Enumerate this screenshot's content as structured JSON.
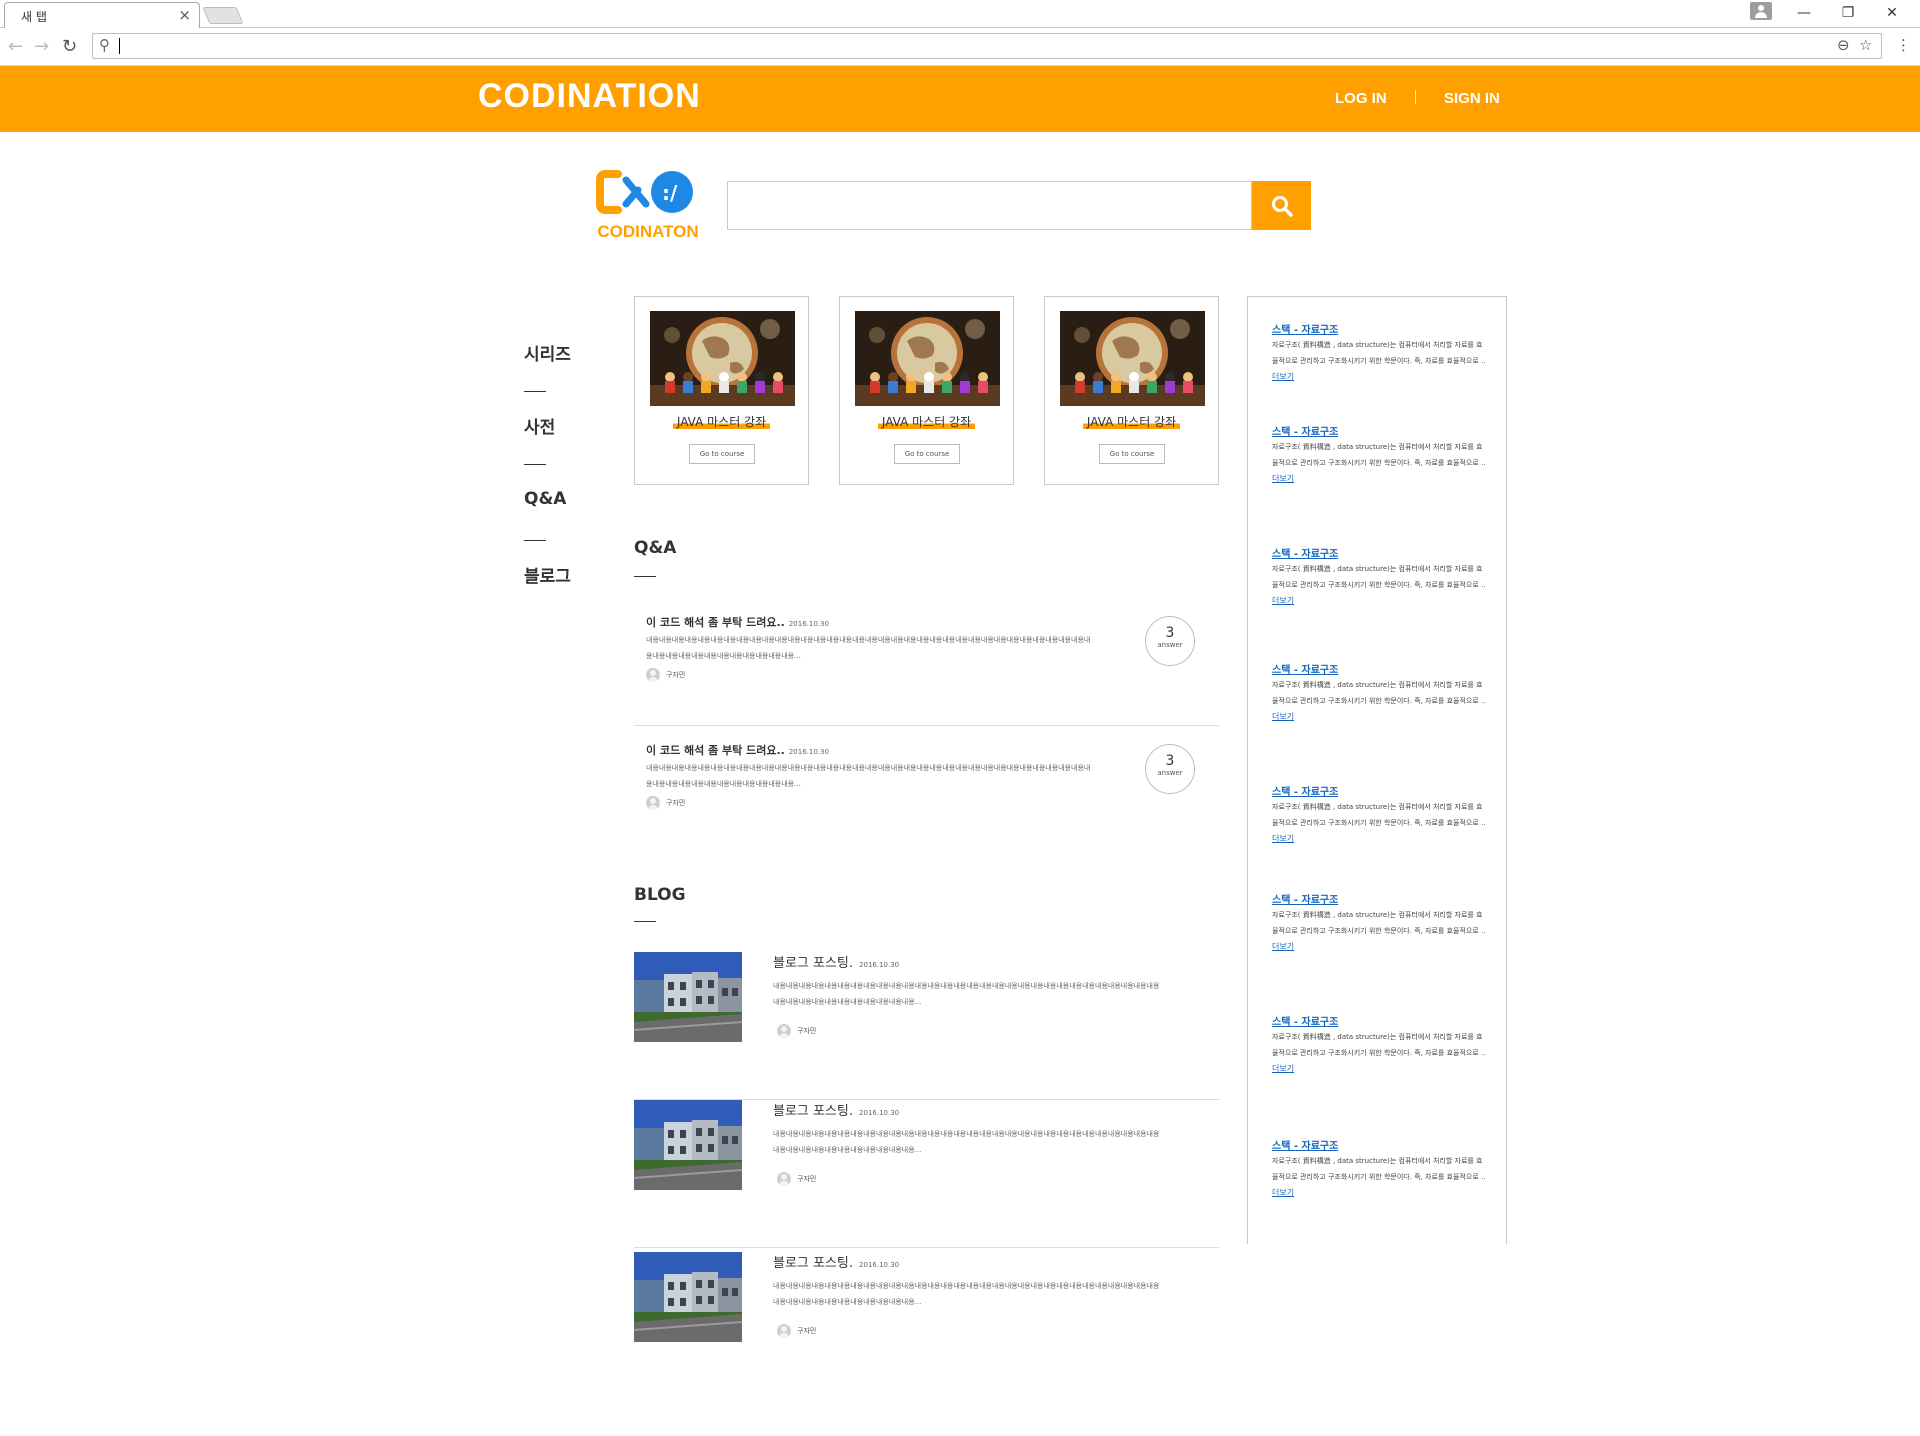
{
  "browser": {
    "tab_title": "새 탭",
    "tab_close": "×",
    "win_minimize": "—",
    "win_restore": "❐",
    "win_close": "✕",
    "back": "←",
    "forward": "→",
    "reload": "↻",
    "search_glyph": "⚲",
    "zoom_glyph": "⊖",
    "star_glyph": "☆",
    "menu_glyph": "⋮"
  },
  "header": {
    "brand": "CODINATION",
    "login": "LOG IN",
    "signin": "SIGN IN",
    "color": "#ffa000"
  },
  "logo": {
    "text": "CODINATON",
    "colors": {
      "orange": "#ffa000",
      "blue": "#1e88e5"
    }
  },
  "search": {
    "placeholder": "",
    "icon": "search-icon"
  },
  "side_nav": {
    "items": [
      "시리즈",
      "사전",
      "Q&A",
      "블로그"
    ]
  },
  "courses": [
    {
      "title": "JAVA 마스터 강좌",
      "button": "Go to course"
    },
    {
      "title": "JAVA 마스터 강좌",
      "button": "Go to course"
    },
    {
      "title": "JAVA 마스터 강좌",
      "button": "Go to course"
    }
  ],
  "qa": {
    "title": "Q&A",
    "items": [
      {
        "title": "이 코드 해석 좀 부탁 드려요..",
        "date": "2016.10.30",
        "body": "내용내용내용내용내용내용내용내용내용내용내용내용내용내용내용내용내용내용내용내용내용내용내용내용내용내용내용내용내용내용내용내용내용내용내용내용내용내용내용내용내용내용내용내용내용내용...",
        "author": "구자민",
        "answers": "3",
        "answer_label": "answer"
      },
      {
        "title": "이 코드 해석 좀 부탁 드려요..",
        "date": "2016.10.30",
        "body": "내용내용내용내용내용내용내용내용내용내용내용내용내용내용내용내용내용내용내용내용내용내용내용내용내용내용내용내용내용내용내용내용내용내용내용내용내용내용내용내용내용내용내용내용내용내용...",
        "author": "구자민",
        "answers": "3",
        "answer_label": "answer"
      }
    ]
  },
  "blog": {
    "title": "BLOG",
    "items": [
      {
        "title": "블로그 포스팅.",
        "date": "2016.10.30",
        "body": "내용내용내용내용내용내용내용내용내용내용내용내용내용내용내용내용내용내용내용내용내용내용내용내용내용내용내용내용내용내용내용내용내용내용내용내용내용내용내용내용내용...",
        "author": "구자민"
      },
      {
        "title": "블로그 포스팅.",
        "date": "2016.10.30",
        "body": "내용내용내용내용내용내용내용내용내용내용내용내용내용내용내용내용내용내용내용내용내용내용내용내용내용내용내용내용내용내용내용내용내용내용내용내용내용내용내용내용내용...",
        "author": "구자민"
      },
      {
        "title": "블로그 포스팅.",
        "date": "2016.10.30",
        "body": "내용내용내용내용내용내용내용내용내용내용내용내용내용내용내용내용내용내용내용내용내용내용내용내용내용내용내용내용내용내용내용내용내용내용내용내용내용내용내용내용내용...",
        "author": "구자민"
      }
    ]
  },
  "dictionary": {
    "items": [
      {
        "title": "스택 - 자료구조",
        "body": "자료구조( 資料構造 , data structure)는 컴퓨터에서 처리할 자료를 효율적으로 관리하고 구조화시키기 위한 학문이다. 즉, 자료를 효율적으로 ..",
        "more": "더보기"
      },
      {
        "title": "스택 - 자료구조",
        "body": "자료구조( 資料構造 , data structure)는 컴퓨터에서 처리할 자료를 효율적으로 관리하고 구조화시키기 위한 학문이다. 즉, 자료를 효율적으로 ..",
        "more": "더보기"
      },
      {
        "title": "스택 - 자료구조",
        "body": "자료구조( 資料構造 , data structure)는 컴퓨터에서 처리할 자료를 효율적으로 관리하고 구조화시키기 위한 학문이다. 즉, 자료를 효율적으로 ..",
        "more": "더보기"
      },
      {
        "title": "스택 - 자료구조",
        "body": "자료구조( 資料構造 , data structure)는 컴퓨터에서 처리할 자료를 효율적으로 관리하고 구조화시키기 위한 학문이다. 즉, 자료를 효율적으로 ..",
        "more": "더보기"
      },
      {
        "title": "스택 - 자료구조",
        "body": "자료구조( 資料構造 , data structure)는 컴퓨터에서 처리할 자료를 효율적으로 관리하고 구조화시키기 위한 학문이다. 즉, 자료를 효율적으로 ..",
        "more": "더보기"
      },
      {
        "title": "스택 - 자료구조",
        "body": "자료구조( 資料構造 , data structure)는 컴퓨터에서 처리할 자료를 효율적으로 관리하고 구조화시키기 위한 학문이다. 즉, 자료를 효율적으로 ..",
        "more": "더보기"
      },
      {
        "title": "스택 - 자료구조",
        "body": "자료구조( 資料構造 , data structure)는 컴퓨터에서 처리할 자료를 효율적으로 관리하고 구조화시키기 위한 학문이다. 즉, 자료를 효율적으로 ..",
        "more": "더보기"
      },
      {
        "title": "스택 - 자료구조",
        "body": "자료구조( 資料構造 , data structure)는 컴퓨터에서 처리할 자료를 효율적으로 관리하고 구조화시키기 위한 학문이다. 즉, 자료를 효율적으로 ..",
        "more": "더보기"
      }
    ]
  }
}
